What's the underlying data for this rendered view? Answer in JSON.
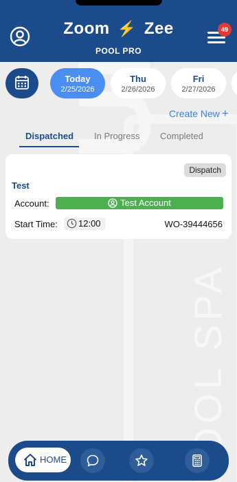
{
  "header": {
    "title_left": "Zoom",
    "title_bolt": "⚡",
    "title_right": "Zee",
    "subtitle": "POOL PRO",
    "notification_count": "49"
  },
  "dates": [
    {
      "day": "Today",
      "date": "2/25/2026",
      "selected": true
    },
    {
      "day": "Thu",
      "date": "2/26/2026",
      "selected": false
    },
    {
      "day": "Fri",
      "date": "2/27/2026",
      "selected": false
    }
  ],
  "actions": {
    "create_new": "Create New",
    "create_new_icon": "+"
  },
  "tabs": [
    {
      "label": "Dispatched",
      "active": true
    },
    {
      "label": "In Progress",
      "active": false
    },
    {
      "label": "Completed",
      "active": false
    }
  ],
  "work_order": {
    "status_badge": "Dispatch",
    "title": "Test",
    "account_label": "Account:",
    "account_name": "Test Account",
    "start_time_label": "Start Time:",
    "start_time": "12:00",
    "wo_number": "WO-39444656"
  },
  "bottom_nav": {
    "home_label": "HOME",
    "items": [
      "home-icon",
      "chat-icon",
      "star-icon",
      "calculator-icon"
    ]
  },
  "colors": {
    "primary": "#1b4b8a",
    "accent": "#4a8ef2",
    "success": "#4caf50",
    "badge": "#e53935",
    "bolt": "#f6c12a"
  }
}
